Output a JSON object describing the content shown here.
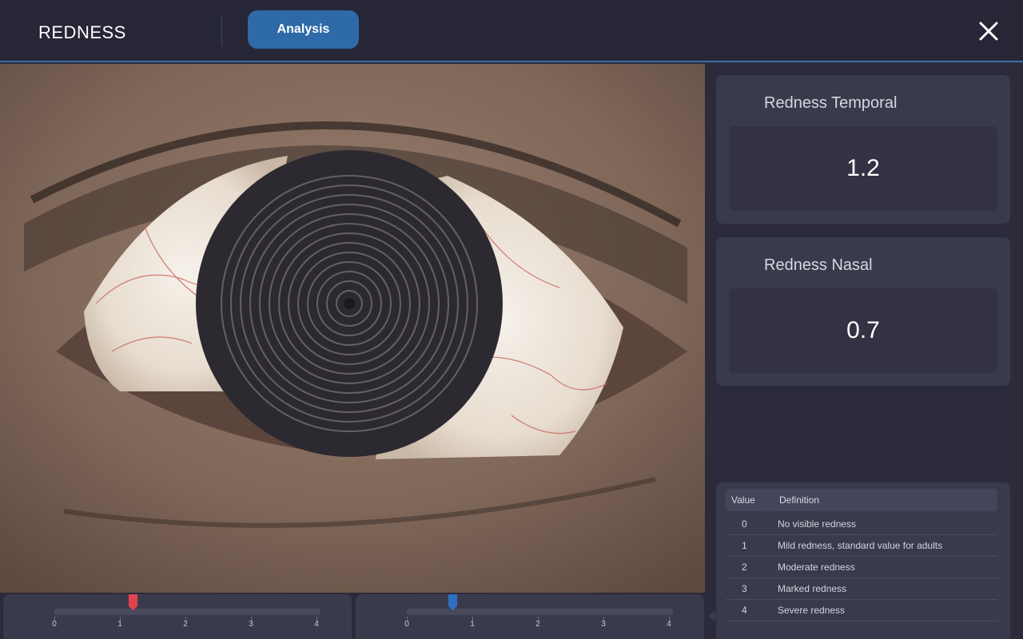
{
  "header": {
    "title": "REDNESS",
    "analysis_label": "Analysis"
  },
  "image": {
    "icon": "eye-photo-placido-rings"
  },
  "cards": {
    "temporal": {
      "label": "Redness Temporal",
      "value": "1.2"
    },
    "nasal": {
      "label": "Redness Nasal",
      "value": "0.7"
    }
  },
  "table": {
    "headers": {
      "value": "Value",
      "definition": "Definition"
    },
    "rows": [
      {
        "value": "0",
        "definition": "No visible redness"
      },
      {
        "value": "1",
        "definition": "Mild redness, standard value for adults"
      },
      {
        "value": "2",
        "definition": "Moderate redness"
      },
      {
        "value": "3",
        "definition": "Marked redness"
      },
      {
        "value": "4",
        "definition": "Severe redness"
      }
    ]
  },
  "sliders": {
    "ticks": [
      "0",
      "1",
      "2",
      "3",
      "4"
    ],
    "temporal": {
      "value": 1.2,
      "color": "#e0444f"
    },
    "nasal": {
      "value": 0.7,
      "color": "#2f6fc0"
    }
  },
  "colors": {
    "accent": "#2f6aa8",
    "background": "#2b2b3c"
  }
}
